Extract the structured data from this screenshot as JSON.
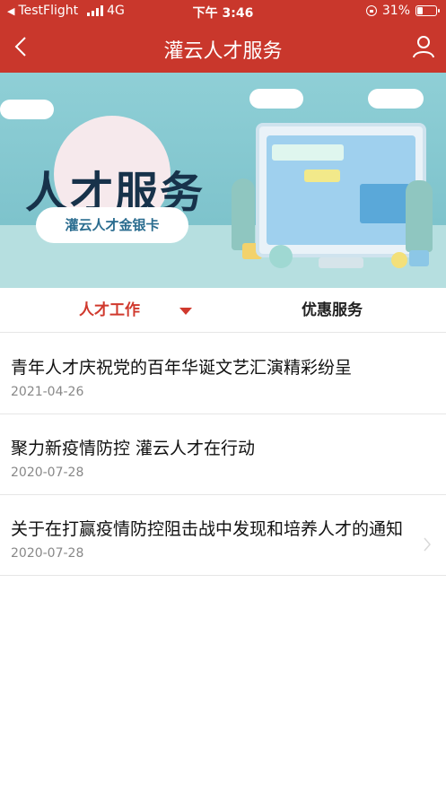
{
  "status_bar": {
    "carrier": "TestFlight",
    "network": "4G",
    "time": "下午 3:46",
    "battery_percent": "31%",
    "battery_level": 0.31
  },
  "nav": {
    "title": "灌云人才服务",
    "back_icon": "chevron-left-icon",
    "user_icon": "user-icon"
  },
  "banner": {
    "headline": "人才服务",
    "card_label": "灌云人才金银卡"
  },
  "tabs": [
    {
      "label": "人才工作",
      "active": true
    },
    {
      "label": "优惠服务",
      "active": false
    }
  ],
  "articles": [
    {
      "title": "青年人才庆祝党的百年华诞文艺汇演精彩纷呈",
      "date": "2021-04-26"
    },
    {
      "title": "聚力新疫情防控 灌云人才在行动",
      "date": "2020-07-28"
    },
    {
      "title": "关于在打赢疫情防控阻击战中发现和培养人才的通知",
      "date": "2020-07-28"
    }
  ],
  "colors": {
    "brand_red": "#c9372c",
    "tab_active": "#d0392d"
  }
}
